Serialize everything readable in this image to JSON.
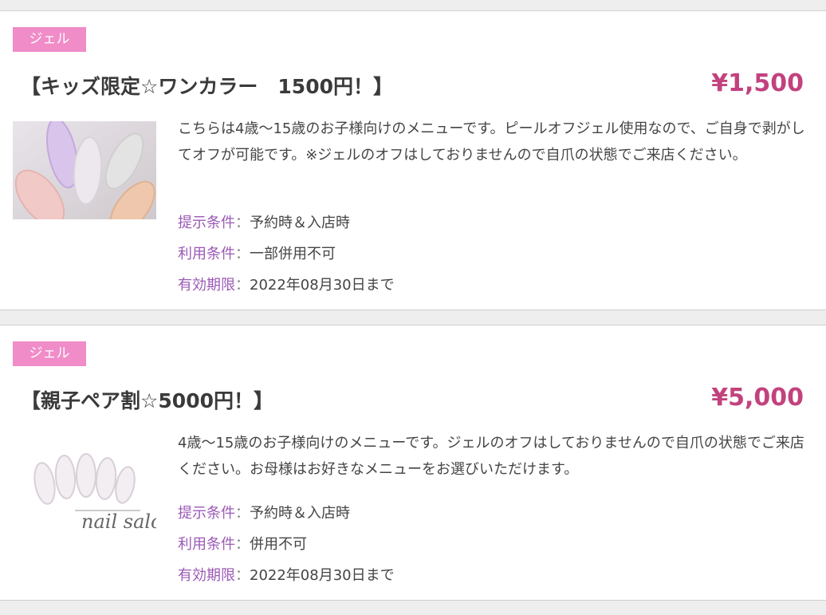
{
  "coupons": [
    {
      "tag": "ジェル",
      "title": "【キッズ限定☆ワンカラー　1500円！】",
      "price": "¥1,500",
      "description": "こちらは4歳〜15歳のお子様向けのメニューです。ピールオフジェル使用なので、ご自身で剥がしてオフが可能です。※ジェルのオフはしておりませんので自爪の状態でご来店ください。",
      "conditions": [
        {
          "label": "提示条件",
          "separator": "：",
          "value": "予約時＆入店時"
        },
        {
          "label": "利用条件",
          "separator": "：",
          "value": "一部併用不可"
        },
        {
          "label": "有効期限",
          "separator": "：",
          "value": "2022年08月30日まで"
        }
      ]
    },
    {
      "tag": "ジェル",
      "title": "【親子ペア割☆5000円！】",
      "price": "¥5,000",
      "description": "4歳〜15歳のお子様向けのメニューです。ジェルのオフはしておりませんので自爪の状態でご来店ください。お母様はお好きなメニューをお選びいただけます。",
      "image_text": "nail salon TN",
      "conditions": [
        {
          "label": "提示条件",
          "separator": "：",
          "value": "予約時＆入店時"
        },
        {
          "label": "利用条件",
          "separator": "：",
          "value": "併用不可"
        },
        {
          "label": "有効期限",
          "separator": "：",
          "value": "2022年08月30日まで"
        }
      ]
    }
  ],
  "colors": {
    "tag_bg": "#f08cc8",
    "price": "#c2427e",
    "condition_label": "#9b59b6"
  }
}
